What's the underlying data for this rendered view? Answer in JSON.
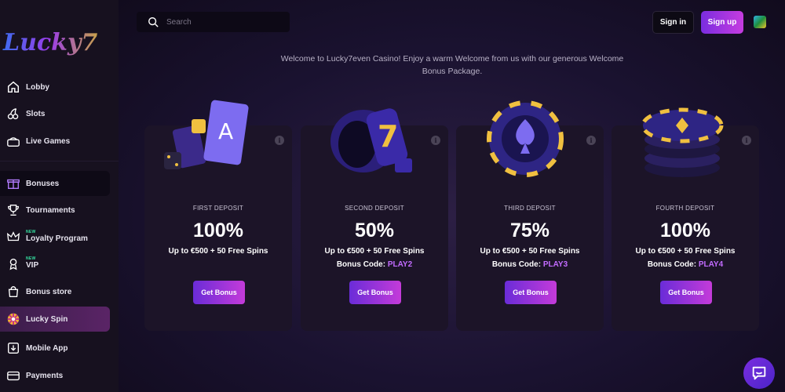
{
  "logo": {
    "text": "Lucky7"
  },
  "sidebar": {
    "items": [
      {
        "label": "Lobby",
        "icon": "home-icon"
      },
      {
        "label": "Slots",
        "icon": "cherries-icon"
      },
      {
        "label": "Live Games",
        "icon": "live-games-icon"
      },
      {
        "label": "Bonuses",
        "icon": "gift-icon"
      },
      {
        "label": "Tournaments",
        "icon": "trophy-icon"
      },
      {
        "label": "Loyalty Program",
        "icon": "crown-icon",
        "badge": "NEW"
      },
      {
        "label": "VIP",
        "icon": "vip-icon",
        "badge": "NEW"
      },
      {
        "label": "Bonus store",
        "icon": "store-bag-icon"
      },
      {
        "label": "Lucky Spin",
        "icon": "wheel-icon"
      },
      {
        "label": "Mobile App",
        "icon": "download-icon"
      },
      {
        "label": "Payments",
        "icon": "card-icon"
      }
    ],
    "active": "Bonuses"
  },
  "header": {
    "search_placeholder": "Search",
    "signin_label": "Sign in",
    "signup_label": "Sign up",
    "flag_icon": "globe-flag-icon"
  },
  "welcome_text": "Welcome to Lucky7even Casino! Enjoy a warm Welcome from us with our generous Welcome Bonus Package.",
  "cards": [
    {
      "label": "FIRST DEPOSIT",
      "percent": "100%",
      "line": "Up to €500 + 50 Free Spins",
      "code_prefix": "",
      "code": "",
      "button": "Get Bonus"
    },
    {
      "label": "SECOND DEPOSIT",
      "percent": "50%",
      "line": "Up to €500 + 50 Free Spins",
      "code_prefix": "Bonus Code: ",
      "code": "PLAY2",
      "button": "Get Bonus"
    },
    {
      "label": "THIRD DEPOSIT",
      "percent": "75%",
      "line": "Up to €500 + 50 Free Spins",
      "code_prefix": "Bonus Code: ",
      "code": "PLAY3",
      "button": "Get Bonus"
    },
    {
      "label": "FOURTH DEPOSIT",
      "percent": "100%",
      "line": "Up to €500 + 50 Free Spins",
      "code_prefix": "Bonus Code: ",
      "code": "PLAY4",
      "button": "Get Bonus"
    }
  ],
  "colors": {
    "accent_gradient_start": "#7a2de0",
    "accent_gradient_end": "#c63ce0",
    "bonus_code": "#c26bff",
    "new_badge": "#35e0a1"
  }
}
